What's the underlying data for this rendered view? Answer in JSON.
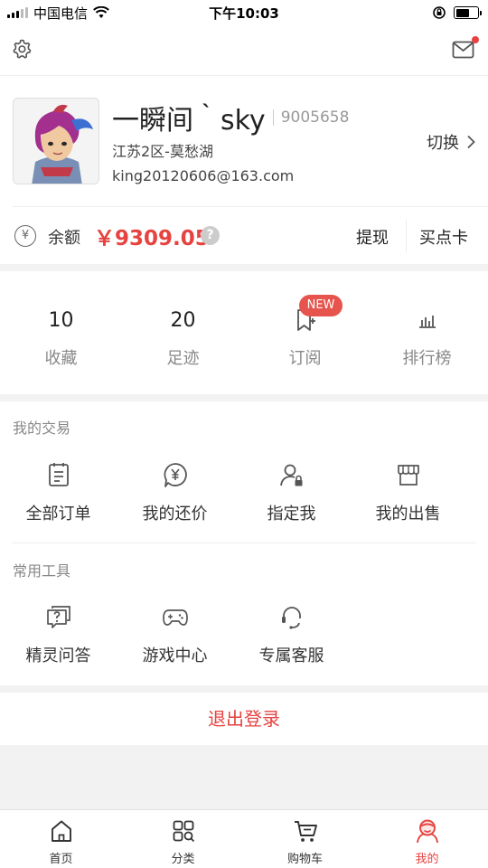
{
  "status_bar": {
    "carrier": "中国电信",
    "time": "下午10:03",
    "battery_level": 0.65
  },
  "profile": {
    "name": "一瞬间｀sky",
    "uid": "9005658",
    "server": "江苏2区-莫愁湖",
    "email": "king20120606@163.com",
    "switch_label": "切换",
    "balance_label": "余额",
    "balance_value": "￥9309.05",
    "withdraw_label": "提现",
    "buy_card_label": "买点卡"
  },
  "stats": {
    "favorites": {
      "count": "10",
      "label": "收藏"
    },
    "footprints": {
      "count": "20",
      "label": "足迹"
    },
    "subscribe": {
      "label": "订阅",
      "badge": "NEW"
    },
    "ranking": {
      "label": "排行榜"
    }
  },
  "trade": {
    "title": "我的交易",
    "items": [
      {
        "label": "全部订单",
        "icon": "order-list-icon"
      },
      {
        "label": "我的还价",
        "icon": "counter-offer-icon"
      },
      {
        "label": "指定我",
        "icon": "designated-user-icon"
      },
      {
        "label": "我的出售",
        "icon": "shop-icon"
      }
    ]
  },
  "tools": {
    "title": "常用工具",
    "items": [
      {
        "label": "精灵问答",
        "icon": "question-chat-icon"
      },
      {
        "label": "游戏中心",
        "icon": "gamepad-icon"
      },
      {
        "label": "专属客服",
        "icon": "headset-icon"
      }
    ]
  },
  "logout_label": "退出登录",
  "tabbar": {
    "items": [
      {
        "label": "首页",
        "icon": "home-icon"
      },
      {
        "label": "分类",
        "icon": "category-icon"
      },
      {
        "label": "购物车",
        "icon": "cart-icon"
      },
      {
        "label": "我的",
        "icon": "profile-face-icon",
        "active": true
      }
    ]
  },
  "colors": {
    "accent": "#e64340",
    "text": "#333333",
    "muted": "#888888"
  }
}
